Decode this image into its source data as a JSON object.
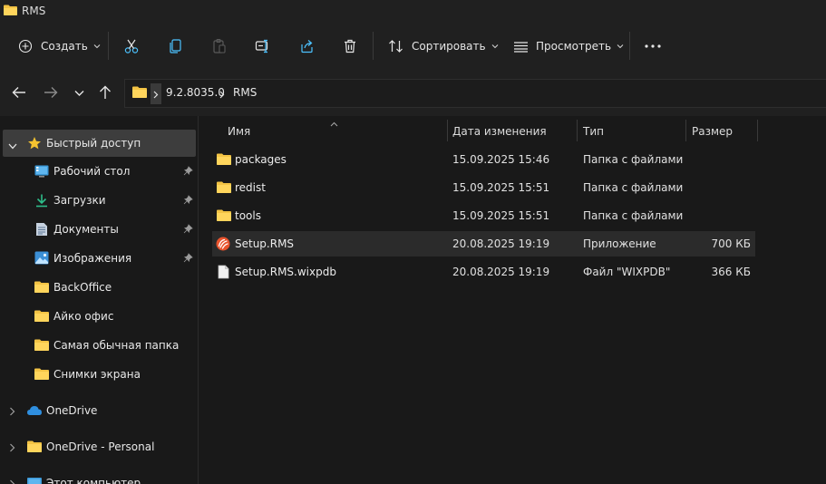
{
  "window": {
    "title": "RMS"
  },
  "toolbar": {
    "create_label": "Создать",
    "sort_label": "Сортировать",
    "view_label": "Просмотреть"
  },
  "address": {
    "segments": [
      "9.2.8035.0",
      "RMS"
    ]
  },
  "sidebar": {
    "quick_access": "Быстрый доступ",
    "items": [
      {
        "label": "Рабочий стол",
        "icon": "desktop-icon",
        "pinned": true
      },
      {
        "label": "Загрузки",
        "icon": "download-icon",
        "pinned": true
      },
      {
        "label": "Документы",
        "icon": "document-icon",
        "pinned": true
      },
      {
        "label": "Изображения",
        "icon": "pictures-icon",
        "pinned": true
      },
      {
        "label": "BackOffice",
        "icon": "folder-icon",
        "pinned": false
      },
      {
        "label": "Айко офис",
        "icon": "folder-icon",
        "pinned": false
      },
      {
        "label": "Самая обычная папка",
        "icon": "folder-icon",
        "pinned": false
      },
      {
        "label": "Снимки экрана",
        "icon": "folder-icon",
        "pinned": false
      }
    ],
    "onedrive": "OneDrive",
    "onedrive_personal": "OneDrive - Personal",
    "this_pc": "Этот компьютер"
  },
  "columns": {
    "name": "Имя",
    "date": "Дата изменения",
    "type": "Тип",
    "size": "Размер"
  },
  "files": [
    {
      "name": "packages",
      "date": "15.09.2025 15:46",
      "type": "Папка с файлами",
      "size": "",
      "icon": "folder-icon"
    },
    {
      "name": "redist",
      "date": "15.09.2025 15:51",
      "type": "Папка с файлами",
      "size": "",
      "icon": "folder-icon"
    },
    {
      "name": "tools",
      "date": "15.09.2025 15:51",
      "type": "Папка с файлами",
      "size": "",
      "icon": "folder-icon"
    },
    {
      "name": "Setup.RMS",
      "date": "20.08.2025 19:19",
      "type": "Приложение",
      "size": "700 КБ",
      "icon": "app-icon"
    },
    {
      "name": "Setup.RMS.wixpdb",
      "date": "20.08.2025 19:19",
      "type": "Файл \"WIXPDB\"",
      "size": "366 КБ",
      "icon": "file-icon"
    }
  ],
  "colors": {
    "folder": "#f3c344",
    "accent": "#4cc2ff",
    "star": "#f5c330",
    "app": "#e8532d"
  }
}
